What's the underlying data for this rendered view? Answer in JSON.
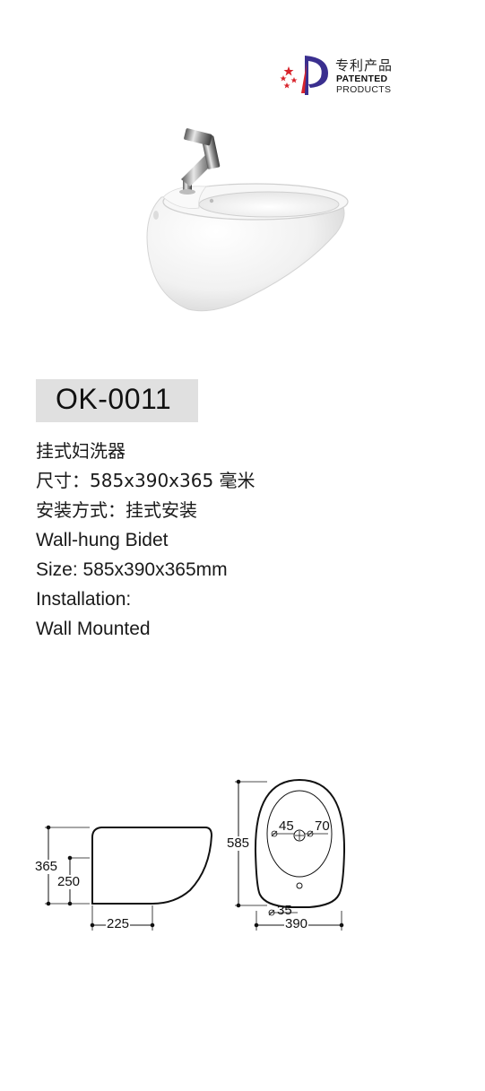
{
  "badge": {
    "cn": "专利产品",
    "line1": "PATENTED",
    "line2": "PRODUCTS"
  },
  "model": "OK-0011",
  "specs": [
    "挂式妇洗器",
    "尺寸：585x390x365 毫米",
    "安装方式：挂式安装",
    "Wall-hung Bidet",
    "Size: 585x390x365mm",
    "Installation:",
    "Wall Mounted"
  ],
  "drawing": {
    "side": {
      "height_total": "365",
      "height_lower": "250",
      "depth": "225"
    },
    "top": {
      "length": "585",
      "width": "390",
      "hole_a": "45",
      "hole_b": "70",
      "hole_c": "35"
    }
  },
  "colors": {
    "model_box": "#e0e0e0",
    "badge_red": "#d8242c",
    "badge_purple": "#3a2f8f"
  }
}
